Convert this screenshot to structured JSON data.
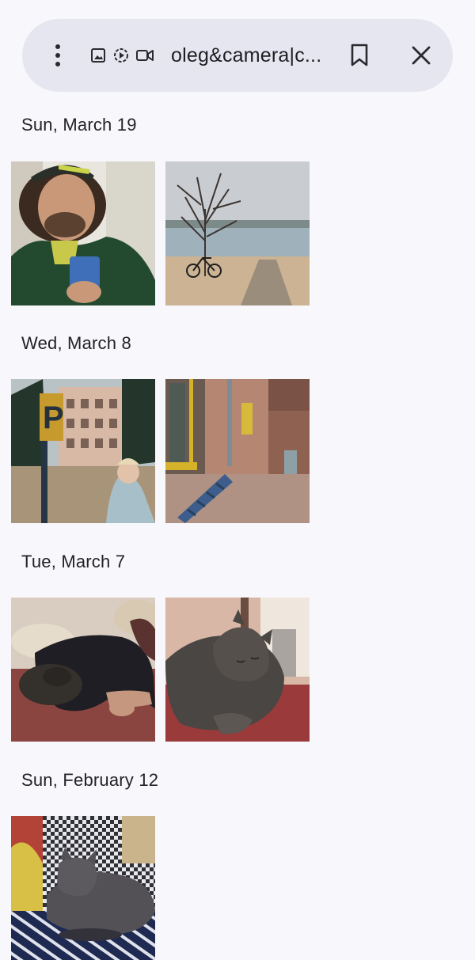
{
  "search": {
    "query": "oleg&camera|c...",
    "icons": {
      "more": "more-vert-icon",
      "image": "image-icon",
      "gif": "gif-icon",
      "video": "video-icon",
      "bookmark": "bookmark-icon",
      "close": "close-icon"
    }
  },
  "sections": [
    {
      "date": "Sun, March 19",
      "photos": [
        "selfie-cyclist-photo",
        "tree-bicycle-beach-photo"
      ]
    },
    {
      "date": "Wed, March 8",
      "photos": [
        "parking-sign-woman-photo",
        "brick-building-ladder-photo"
      ]
    },
    {
      "date": "Tue, March 7",
      "photos": [
        "person-sleeping-with-cat-photo",
        "sleeping-cat-photo"
      ]
    },
    {
      "date": "Sun, February 12",
      "photos": [
        "cat-on-blanket-photo"
      ]
    }
  ],
  "colors": {
    "background": "#f8f8fc",
    "search_bar": "#e6e6f0",
    "text": "#1d1d20"
  }
}
